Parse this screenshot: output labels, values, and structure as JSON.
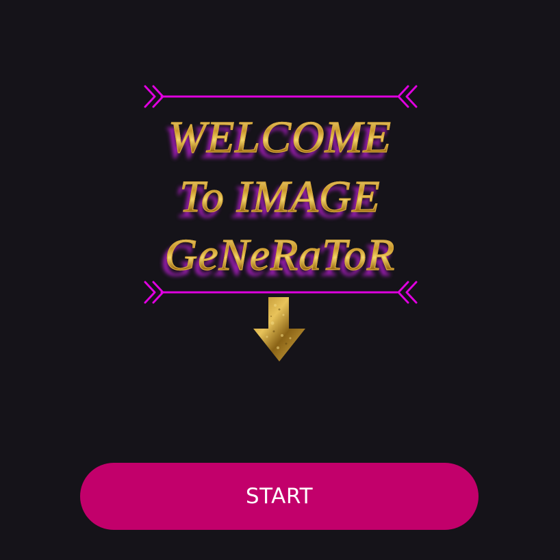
{
  "banner": {
    "line1": "WELCOME",
    "line2": "To IMAGE",
    "line3": "GeNeRaToR",
    "divider_icon": "arrow-divider-icon",
    "arrow_icon": "down-arrow-icon"
  },
  "start_button": {
    "label": "START"
  },
  "colors": {
    "background": "#151319",
    "accent_magenta": "#e000e0",
    "gold": "#c8962a",
    "button": "#c2006b",
    "button_text": "#ffffff"
  }
}
